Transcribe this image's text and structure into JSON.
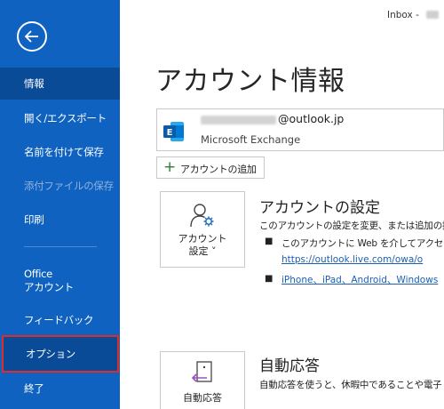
{
  "topbar": {
    "inbox_label": "Inbox -"
  },
  "sidebar": {
    "items": [
      {
        "label": "情報"
      },
      {
        "label": "開く/エクスポート"
      },
      {
        "label": "名前を付けて保存"
      },
      {
        "label": "添付ファイルの保存"
      },
      {
        "label": "印刷"
      },
      {
        "label": "Office",
        "label2": "アカウント"
      },
      {
        "label": "フィードバック"
      },
      {
        "label": "オプション"
      },
      {
        "label": "終了"
      }
    ]
  },
  "main": {
    "title": "アカウント情報",
    "account": {
      "email_domain": "@outlook.jp",
      "type": "Microsoft Exchange"
    },
    "add_account_label": "アカウントの追加",
    "account_settings": {
      "tile_label1": "アカウント",
      "tile_label2": "設定 ˅",
      "heading": "アカウントの設定",
      "description": "このアカウントの設定を変更、または追加の接",
      "bullet1": "このアカウントに Web を介してアクセスし",
      "link1": "https://outlook.live.com/owa/o",
      "bullet2_link": "iPhone、iPad、Android、Windows"
    },
    "auto_reply": {
      "tile_label": "自動応答",
      "heading": "自動応答",
      "description": "自動応答を使うと、休暇中であることや電子"
    }
  },
  "colors": {
    "sidebar": "#0f62c0",
    "sidebar_active": "#0a4b98",
    "highlight": "#e02b2b",
    "link": "#1b5fb3"
  }
}
